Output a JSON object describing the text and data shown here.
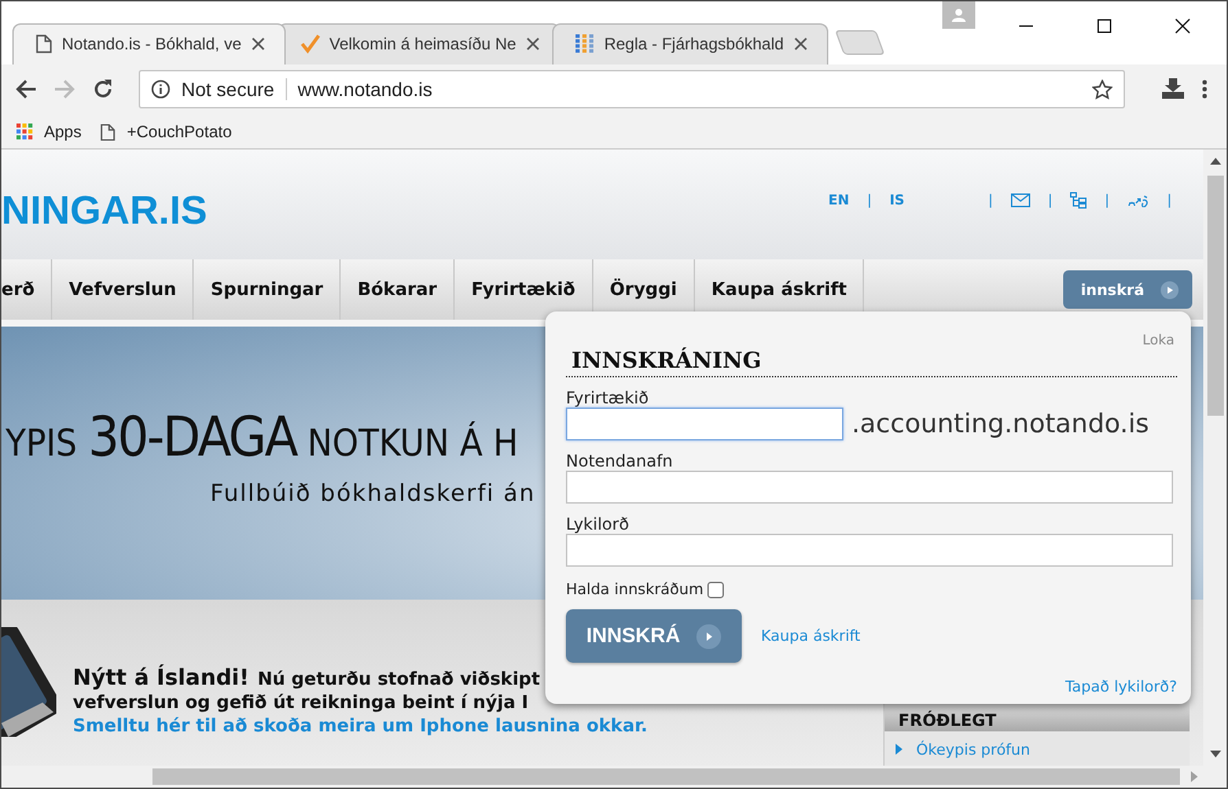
{
  "browser": {
    "tabs": [
      {
        "title": "Notando.is - Bókhald, ve",
        "selected": true,
        "kind": "page"
      },
      {
        "title": "Velkomin á heimasíðu Ne",
        "selected": false,
        "kind": "check"
      },
      {
        "title": "Regla - Fjárhagsbókhald",
        "selected": false,
        "kind": "grid"
      }
    ],
    "security": "Not secure",
    "url": "www.notando.is",
    "bookmarks": [
      {
        "label": "Apps",
        "kind": "apps"
      },
      {
        "label": "+CouchPotato",
        "kind": "page"
      }
    ]
  },
  "header": {
    "logo": "NINGAR.IS",
    "languages": [
      "EN",
      "IS"
    ],
    "separator": "|"
  },
  "nav": {
    "items": [
      "erð",
      "Vefverslun",
      "Spurningar",
      "Bókarar",
      "Fyrirtækið",
      "Öryggi",
      "Kaupa áskrift"
    ],
    "login_button": "innskrá"
  },
  "banner": {
    "headline": [
      "YPIS",
      "30-DAGA",
      "NOTKUN Á H"
    ],
    "subtitle": "Fullbúið bókhaldskerfi án"
  },
  "promo": {
    "headline": "Nýtt á Íslandi!",
    "lines": [
      "Nú geturðu stofnað viðskipt",
      "vefverslun og gefið út reikninga beint í nýja I"
    ],
    "link": "Smelltu hér til að skoða meira um Iphone lausnina okkar."
  },
  "sidebar": {
    "heading": "FRÓÐLEGT",
    "links": [
      "Ókeypis prófun"
    ]
  },
  "login": {
    "title": "INNSKRÁNING",
    "close": "Loka",
    "fields": [
      {
        "label": "Fyrirtækið",
        "suffix": ".accounting.notando.is",
        "focused": true
      },
      {
        "label": "Notendanafn",
        "focused": false
      },
      {
        "label": "Lykilorð",
        "focused": false
      }
    ],
    "remember": {
      "label": "Halda innskráðum",
      "checked": false
    },
    "submit": "INNSKRÁ",
    "subscribe_link": "Kaupa áskrift",
    "forgot_link": "Tapað lykilorð?"
  }
}
